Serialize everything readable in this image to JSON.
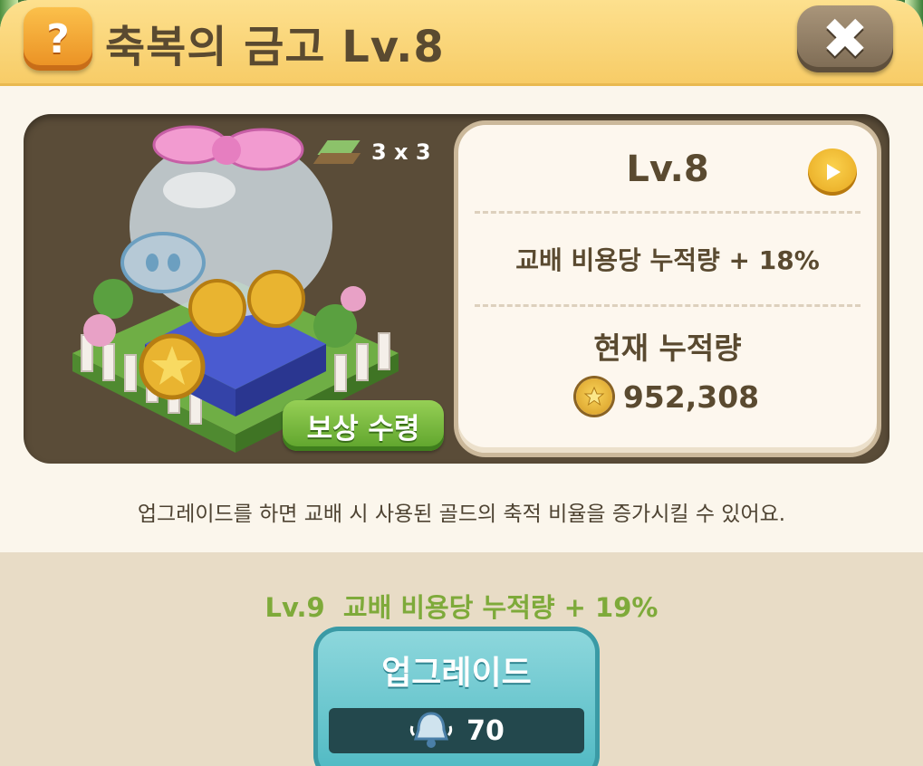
{
  "header": {
    "help_label": "?",
    "title": "축복의 금고 Lv.8",
    "close_label": "✖"
  },
  "building": {
    "size": "3 x 3",
    "reward_button": "보상 수령"
  },
  "info": {
    "level": "Lv.8",
    "rate": "교배 비용당 누적량 + 18%",
    "current_label": "현재 누적량",
    "current_amount": "952,308"
  },
  "description": "업그레이드를 하면 교배 시 사용된 골드의 축적 비율을 증가시킬 수 있어요.",
  "upgrade": {
    "next_level_text": "Lv.9  교배 비용당 누적량 + 19%",
    "button_label": "업그레이드",
    "cost": "70"
  },
  "icons": {
    "help": "question-icon",
    "close": "close-icon",
    "next": "play-icon",
    "coin": "gold-coin-icon",
    "cost": "bell-icon",
    "tile": "tile-icon"
  }
}
